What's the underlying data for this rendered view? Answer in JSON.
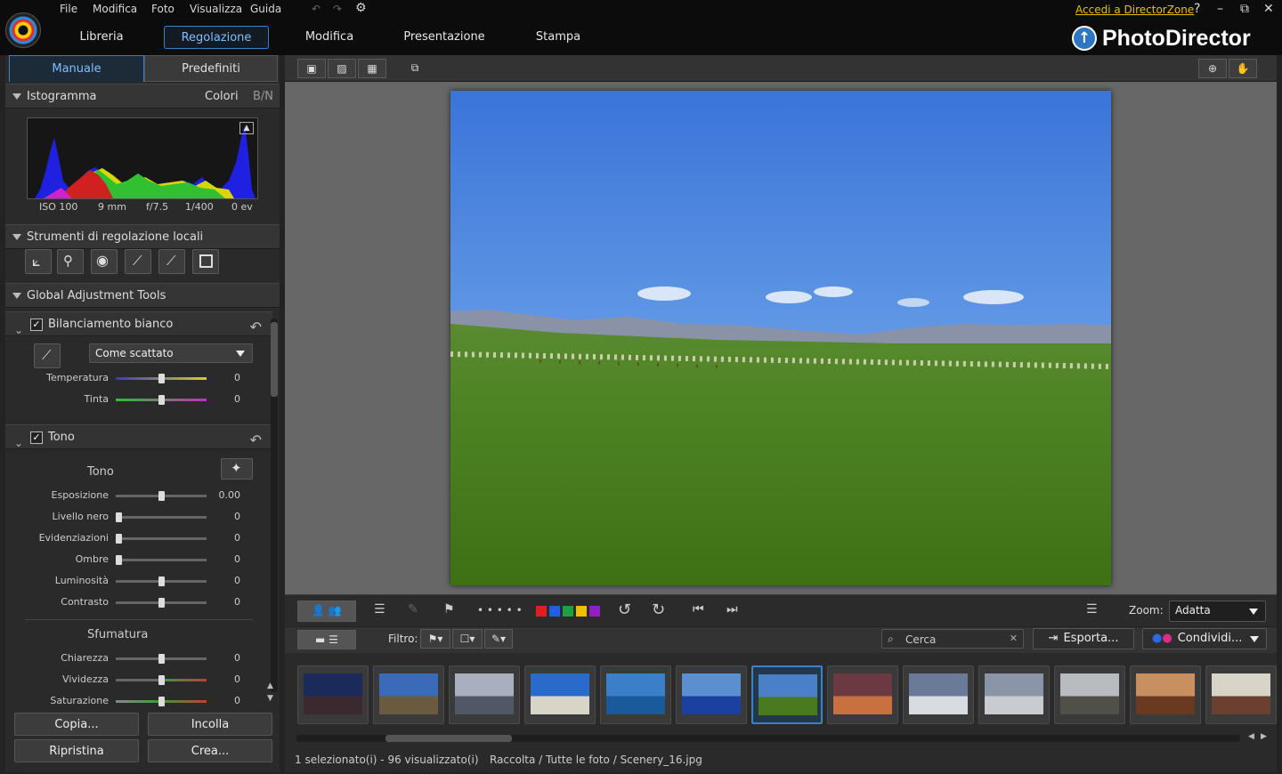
{
  "menu": {
    "file": "File",
    "edit": "Modifica",
    "photo": "Foto",
    "view": "Visualizza",
    "help": "Guida"
  },
  "directorzone_link": "Accedi a DirectorZone",
  "window_controls": {
    "help": "?",
    "minimize": "–",
    "restore": "⧉",
    "close": "✕"
  },
  "nav": {
    "library": "Libreria",
    "adjust": "Regolazione",
    "edit": "Modifica",
    "slideshow": "Presentazione",
    "print": "Stampa"
  },
  "brand": "PhotoDirector",
  "left": {
    "tab_manual": "Manuale",
    "tab_presets": "Predefiniti",
    "histogram": {
      "title": "Istogramma",
      "colors": "Colori",
      "bw": "B/N"
    },
    "exif": {
      "iso": "ISO 100",
      "focal": "9 mm",
      "aperture": "f/7.5",
      "shutter": "1/400",
      "ev": "0 ev"
    },
    "local_tools_title": "Strumenti di regolazione locali",
    "global_tools_title": "Global Adjustment Tools",
    "white_balance": {
      "title": "Bilanciamento bianco",
      "preset": "Come scattato",
      "temperature_label": "Temperatura",
      "temperature_value": "0",
      "temperature_level": 0.5,
      "tint_label": "Tinta",
      "tint_value": "0",
      "tint_level": 0.5
    },
    "tone": {
      "title": "Tono",
      "sub_title": "Tono",
      "sliders": [
        {
          "label": "Esposizione",
          "value": "0.00",
          "level": 0.5
        },
        {
          "label": "Livello nero",
          "value": "0",
          "level": 0.0
        },
        {
          "label": "Evidenziazioni",
          "value": "0",
          "level": 0.0
        },
        {
          "label": "Ombre",
          "value": "0",
          "level": 0.0
        },
        {
          "label": "Luminosità",
          "value": "0",
          "level": 0.5
        },
        {
          "label": "Contrasto",
          "value": "0",
          "level": 0.5
        }
      ],
      "gradient_title": "Sfumatura",
      "gradient_sliders": [
        {
          "label": "Chiarezza",
          "value": "0",
          "level": 0.5
        },
        {
          "label": "Vividezza",
          "value": "0",
          "level": 0.5
        },
        {
          "label": "Saturazione",
          "value": "0",
          "level": 0.5
        }
      ]
    },
    "buttons": {
      "copy": "Copia...",
      "paste": "Incolla",
      "reset": "Ripristina",
      "create": "Crea..."
    }
  },
  "toolbar2": {
    "zoom_label": "Zoom:",
    "zoom_value": "Adatta",
    "rating_dots": "• • • • •"
  },
  "toolbar3": {
    "filter_label": "Filtro:",
    "search_placeholder": "Cerca",
    "export": "Esporta...",
    "share": "Condividi..."
  },
  "color_labels": [
    "#e02020",
    "#2060e0",
    "#20a040",
    "#f0c000",
    "#9020c0"
  ],
  "thumbnails": [
    {
      "name": "night-city",
      "sky": "#1a2a5a",
      "ground": "#3a2a30"
    },
    {
      "name": "eiffel",
      "sky": "#3a6ab8",
      "ground": "#6a5a40"
    },
    {
      "name": "louvre",
      "sky": "#a8b0c0",
      "ground": "#505868"
    },
    {
      "name": "windmills",
      "sky": "#2a6ac8",
      "ground": "#d8d4c8"
    },
    {
      "name": "sea",
      "sky": "#3a80c8",
      "ground": "#1a5a9a"
    },
    {
      "name": "santorini",
      "sky": "#5a90d0",
      "ground": "#1a40a0"
    },
    {
      "name": "steppe",
      "sky": "#4a80c8",
      "ground": "#4a7a20"
    },
    {
      "name": "sunset-tree",
      "sky": "#6a3a40",
      "ground": "#c87040"
    },
    {
      "name": "snow-trees",
      "sky": "#6a7a98",
      "ground": "#d8dce0"
    },
    {
      "name": "snow-river",
      "sky": "#8a96a8",
      "ground": "#c8ccd0"
    },
    {
      "name": "misty-forest",
      "sky": "#b8bcc0",
      "ground": "#505048"
    },
    {
      "name": "wood-interior",
      "sky": "#c89060",
      "ground": "#6a3a20"
    },
    {
      "name": "tools",
      "sky": "#d8d4c8",
      "ground": "#6a4030"
    }
  ],
  "status": {
    "selection": "1 selezionato(i) - 96 visualizzato(i)",
    "path": "Raccolta / Tutte le foto / Scenery_16.jpg"
  }
}
